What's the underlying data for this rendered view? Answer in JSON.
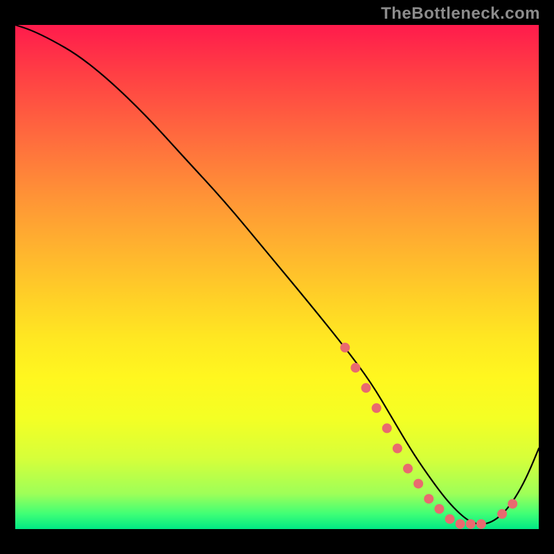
{
  "watermark": "TheBottleneck.com",
  "colors": {
    "dot": "#e96a6f",
    "curve": "#000000"
  },
  "chart_data": {
    "type": "line",
    "title": "",
    "xlabel": "",
    "ylabel": "",
    "xlim": [
      0,
      100
    ],
    "ylim": [
      0,
      100
    ],
    "grid": false,
    "legend": false,
    "x": [
      0,
      3,
      7,
      12,
      18,
      25,
      32,
      40,
      48,
      56,
      63,
      68,
      72,
      76,
      80,
      83,
      86,
      88,
      90,
      92,
      94,
      96,
      98,
      100
    ],
    "values": [
      100,
      99,
      97,
      94,
      89,
      82,
      74,
      65,
      55,
      45,
      36,
      29,
      22,
      15,
      9,
      5,
      2,
      1,
      1,
      2,
      4,
      7,
      11,
      16
    ],
    "dot_points": {
      "x": [
        63,
        65,
        67,
        69,
        71,
        73,
        75,
        77,
        79,
        81,
        83,
        85,
        87,
        89,
        93,
        95
      ],
      "values": [
        36,
        32,
        28,
        24,
        20,
        16,
        12,
        9,
        6,
        4,
        2,
        1,
        1,
        1,
        3,
        5
      ]
    }
  }
}
